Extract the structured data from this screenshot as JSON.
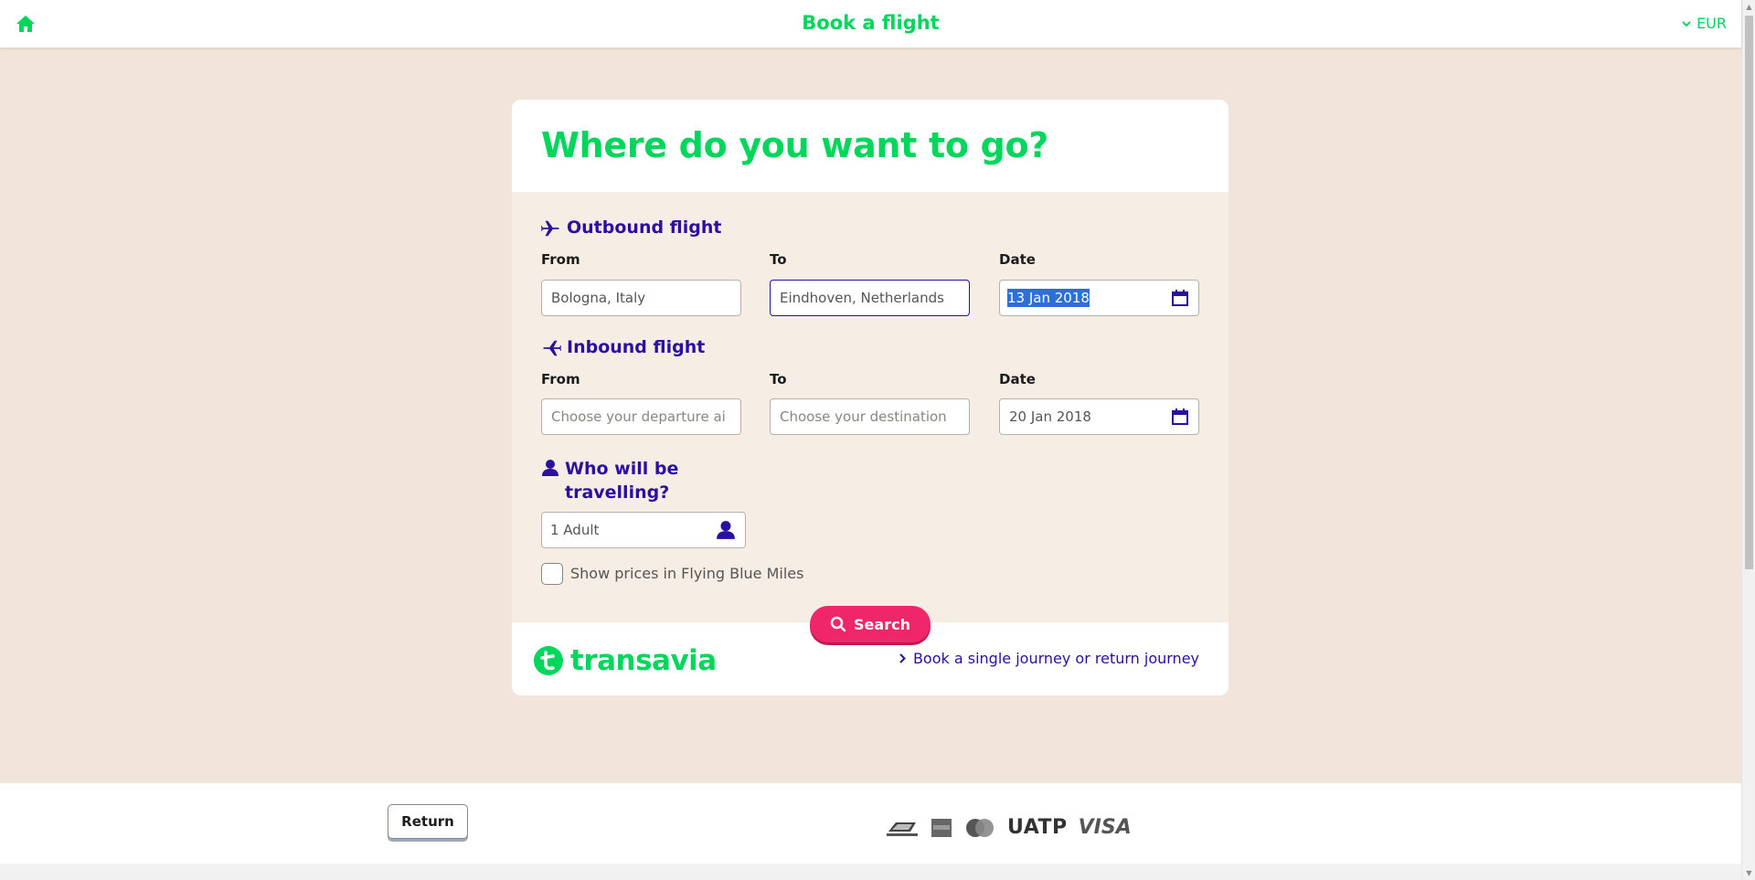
{
  "header": {
    "title": "Book a flight",
    "currency": "EUR",
    "home_icon": "home-icon",
    "currency_icon": "chevron-down-icon"
  },
  "card": {
    "heading": "Where do you want to go?",
    "outbound": {
      "title": "Outbound flight",
      "icon": "plane-outbound-icon",
      "from_label": "From",
      "from_value": "Bologna, Italy",
      "to_label": "To",
      "to_value": "Eindhoven, Netherlands",
      "date_label": "Date",
      "date_value": "13 Jan 2018"
    },
    "inbound": {
      "title": "Inbound flight",
      "icon": "plane-inbound-icon",
      "from_label": "From",
      "from_placeholder": "Choose your departure ai",
      "to_label": "To",
      "to_placeholder": "Choose your destination",
      "date_label": "Date",
      "date_value": "20 Jan 2018"
    },
    "passengers": {
      "title": "Who will be travelling?",
      "icon": "person-icon",
      "value": "1 Adult"
    },
    "flying_blue": {
      "label": "Show prices in Flying Blue Miles",
      "checked": false
    },
    "search_label": "Search",
    "logo_text": "transavia",
    "journey_link": "Book a single journey or return journey"
  },
  "footer": {
    "return_label": "Return",
    "payment_methods": [
      "Bancontact",
      "American Express",
      "MasterCard",
      "UATP",
      "VISA"
    ],
    "uatp_text": "UATP",
    "visa_text": "VISA"
  },
  "colors": {
    "brand_green": "#00d65b",
    "brand_purple": "#2b0fa0",
    "search_pink": "#f0266a",
    "background": "#f1e5da"
  }
}
